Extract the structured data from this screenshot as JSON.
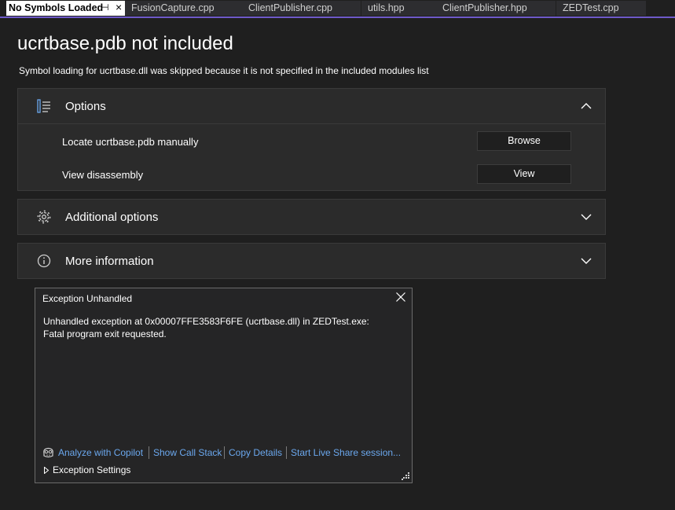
{
  "tabs": [
    {
      "label": "No Symbols Loaded",
      "active": true
    },
    {
      "label": "FusionCapture.cpp"
    },
    {
      "label": "ClientPublisher.cpp"
    },
    {
      "label": "utils.hpp"
    },
    {
      "label": "ClientPublisher.hpp"
    },
    {
      "label": "ZEDTest.cpp"
    }
  ],
  "page": {
    "title": "ucrtbase.pdb not included",
    "subtitle": "Symbol loading for ucrtbase.dll was skipped because it is not specified in the included modules list"
  },
  "options": {
    "label": "Options",
    "icon": "list-options-icon",
    "rows": [
      {
        "label": "Locate ucrtbase.pdb manually",
        "button": "Browse"
      },
      {
        "label": "View disassembly",
        "button": "View"
      }
    ]
  },
  "additional": {
    "label": "Additional options",
    "icon": "gear-icon"
  },
  "more_info": {
    "label": "More information",
    "icon": "info-icon"
  },
  "exception": {
    "title": "Exception Unhandled",
    "message": "Unhandled exception at 0x00007FFE3583F6FE (ucrtbase.dll) in ZEDTest.exe: Fatal program exit requested.",
    "links": [
      "Analyze with Copilot",
      "Show Call Stack",
      "Copy Details",
      "Start Live Share session..."
    ],
    "settings_label": "Exception Settings"
  },
  "colors": {
    "accent": "#6e59c9",
    "link": "#6ba8ee",
    "background": "#1f1f1f",
    "panel": "#2b2b2b"
  }
}
